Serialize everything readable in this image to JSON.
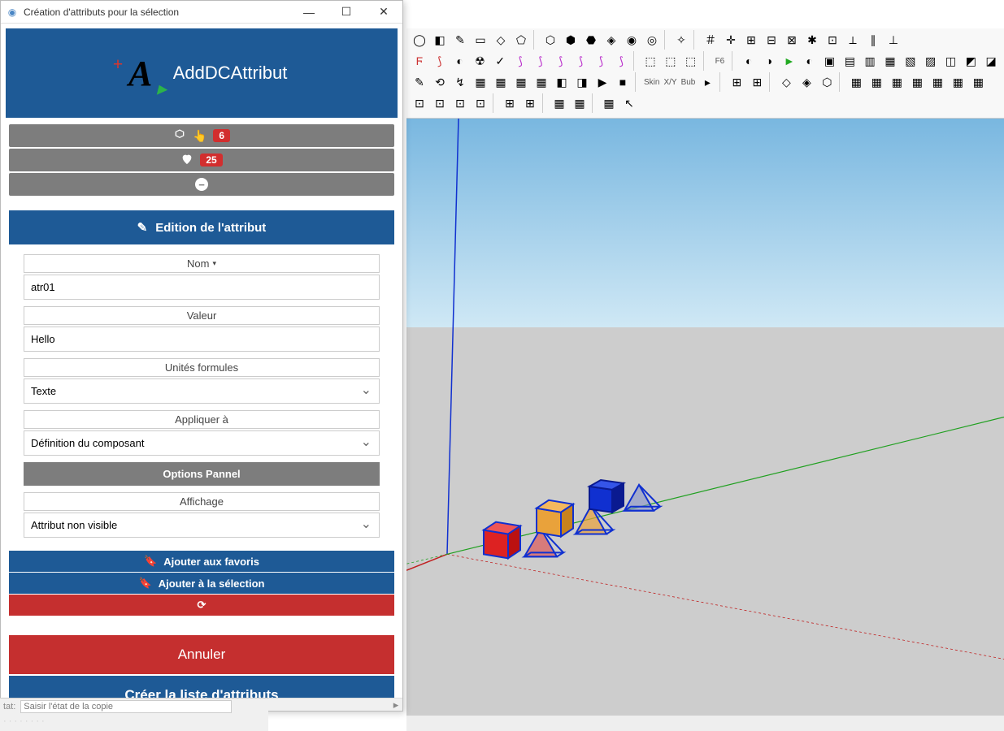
{
  "dialog": {
    "title": "Création d'attributs pour la sélection",
    "brand": "AddDCAttribut"
  },
  "stats": {
    "components_count": "6",
    "favorites_count": "25"
  },
  "section_title": "Edition de l'attribut",
  "form": {
    "name_label": "Nom",
    "name_value": "atr01",
    "value_label": "Valeur",
    "value_value": "Hello",
    "units_label": "Unités formules",
    "units_selected": "Texte",
    "apply_label": "Appliquer à",
    "apply_selected": "Définition du composant",
    "options_pannel": "Options Pannel",
    "display_label": "Affichage",
    "display_selected": "Attribut non visible"
  },
  "favorites": {
    "add_fav": "Ajouter aux favoris",
    "add_sel": "Ajouter à la sélection"
  },
  "buttons": {
    "cancel": "Annuler",
    "create": "Créer la liste d'attributs"
  },
  "bottom": {
    "etat_label": "tat:",
    "etat_placeholder": "Saisir l'état de la copie"
  },
  "toolbar_labels": {
    "skin": "Skin",
    "xy": "X/Y",
    "bub": "Bub",
    "f6": "F6"
  }
}
